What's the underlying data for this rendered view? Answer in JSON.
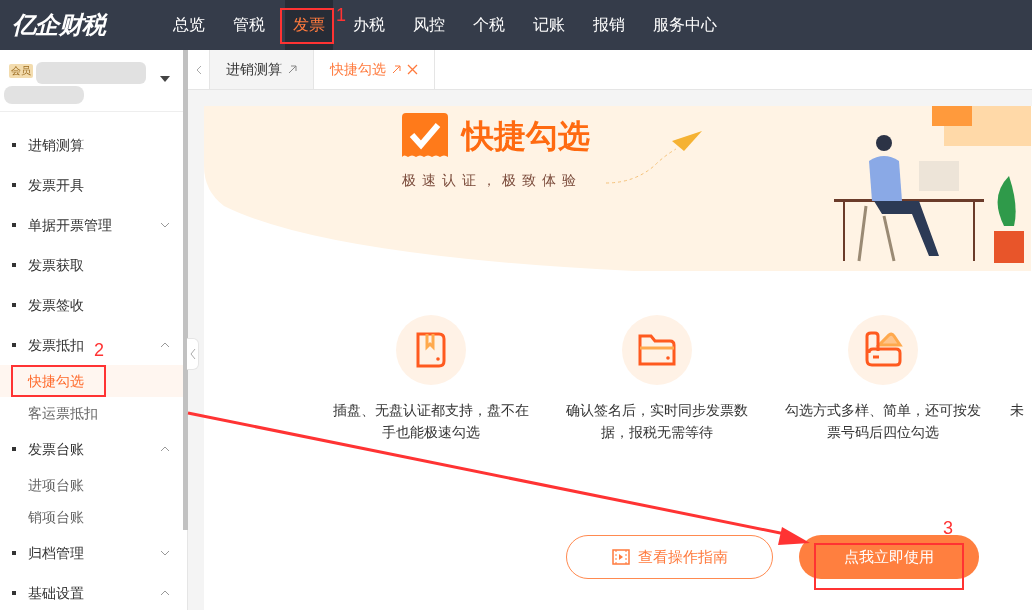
{
  "logo": "亿企财税",
  "nav": [
    {
      "label": "总览",
      "selected": false
    },
    {
      "label": "管税",
      "selected": false
    },
    {
      "label": "发票",
      "selected": true
    },
    {
      "label": "办税",
      "selected": false
    },
    {
      "label": "风控",
      "selected": false
    },
    {
      "label": "个税",
      "selected": false
    },
    {
      "label": "记账",
      "selected": false
    },
    {
      "label": "报销",
      "selected": false
    },
    {
      "label": "服务中心",
      "selected": false
    }
  ],
  "account": {
    "badge": "会员"
  },
  "tabs": [
    {
      "label": "进销测算",
      "selected": false,
      "closable": false
    },
    {
      "label": "快捷勾选",
      "selected": true,
      "closable": true
    }
  ],
  "sidebar": {
    "items": [
      {
        "label": "进销测算"
      },
      {
        "label": "发票开具"
      },
      {
        "label": "单据开票管理",
        "expanded": false
      },
      {
        "label": "发票获取"
      },
      {
        "label": "发票签收"
      },
      {
        "label": "发票抵扣",
        "expanded": true,
        "children": [
          {
            "label": "快捷勾选",
            "selected": true
          },
          {
            "label": "客运票抵扣",
            "selected": false
          }
        ]
      },
      {
        "label": "发票台账",
        "expanded": true,
        "children": [
          {
            "label": "进项台账",
            "selected": false
          },
          {
            "label": "销项台账",
            "selected": false
          }
        ]
      },
      {
        "label": "归档管理",
        "expanded": false
      },
      {
        "label": "基础设置",
        "expanded": true
      }
    ]
  },
  "banner": {
    "title": "快捷勾选",
    "subtitle": "极速认证，极致体验"
  },
  "features": [
    {
      "kind": "book",
      "text": "插盘、无盘认证都支持，盘不在手也能极速勾选"
    },
    {
      "kind": "folder",
      "text": "确认签名后，实时同步发票数据，报税无需等待"
    },
    {
      "kind": "wallet",
      "text": "勾选方式多样、简单，还可按发票号码后四位勾选"
    },
    {
      "kind": "cut",
      "text": "未"
    }
  ],
  "buttons": [
    {
      "label": "查看操作指南",
      "kind": "outline"
    },
    {
      "label": "点我立即使用",
      "kind": "primary"
    }
  ],
  "annotations": [
    {
      "label": "1"
    },
    {
      "label": "2"
    },
    {
      "label": "3"
    }
  ]
}
